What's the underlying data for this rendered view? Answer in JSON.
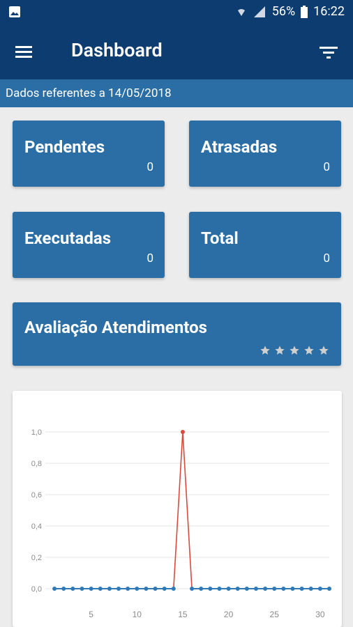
{
  "status": {
    "battery": "56%",
    "time": "16:22",
    "accent": "#0d3d70"
  },
  "header": {
    "title": "Dashboard",
    "menu_icon": "menu-icon",
    "filter_icon": "filter-icon"
  },
  "subheader": {
    "text": "Dados referentes a 14/05/2018"
  },
  "cards": {
    "pendentes": {
      "label": "Pendentes",
      "value": "0"
    },
    "atrasadas": {
      "label": "Atrasadas",
      "value": "0"
    },
    "executadas": {
      "label": "Executadas",
      "value": "0"
    },
    "total": {
      "label": "Total",
      "value": "0"
    }
  },
  "rating": {
    "label": "Avaliação Atendimentos",
    "stars": 0,
    "max_stars": 5,
    "star_color": "#cfcfcf"
  },
  "colors": {
    "card": "#2a6ea5",
    "line_peak": "#d94a3d",
    "line_base": "#2f79b6",
    "grid": "#e6e6e6"
  },
  "chart_data": {
    "type": "line",
    "x": [
      1,
      2,
      3,
      4,
      5,
      6,
      7,
      8,
      9,
      10,
      11,
      12,
      13,
      14,
      15,
      16,
      17,
      18,
      19,
      20,
      21,
      22,
      23,
      24,
      25,
      26,
      27,
      28,
      29,
      30,
      31
    ],
    "series": [
      {
        "values": [
          0,
          0,
          0,
          0,
          0,
          0,
          0,
          0,
          0,
          0,
          0,
          0,
          0,
          0,
          1,
          0,
          0,
          0,
          0,
          0,
          0,
          0,
          0,
          0,
          0,
          0,
          0,
          0,
          0,
          0,
          0
        ]
      }
    ],
    "xlim": [
      0,
      31
    ],
    "ylim": [
      0,
      1
    ],
    "yticks": [
      "0,0",
      "0,2",
      "0,4",
      "0,6",
      "0,8",
      "1,0"
    ],
    "xticks": [
      "5",
      "10",
      "15",
      "20",
      "25",
      "30"
    ],
    "grid": true
  }
}
